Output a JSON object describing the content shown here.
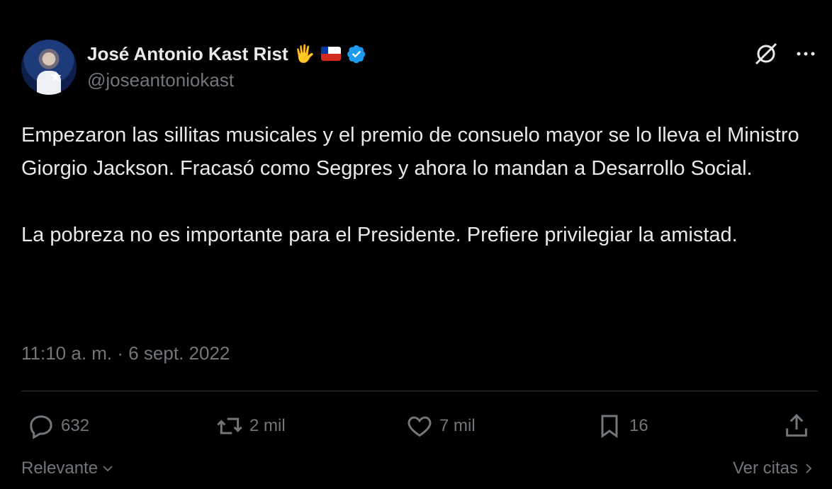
{
  "author": {
    "name": "José Antonio Kast Rist",
    "handle": "@joseantoniokast",
    "emoji": "🖐",
    "verified": true,
    "verified_color": "#1d9bf0"
  },
  "tweet": {
    "paragraphs": [
      "Empezaron las sillitas musicales y el premio de consuelo mayor se lo lleva el Ministro Giorgio Jackson. Fracasó como Segpres y ahora lo mandan a Desarrollo Social.",
      "La pobreza no es importante para el Presidente. Prefiere privilegiar la amistad."
    ],
    "timestamp": "11:10 a. m. · 6 sept. 2022"
  },
  "actions": {
    "replies": "632",
    "reposts": "2 mil",
    "likes": "7 mil",
    "bookmarks": "16"
  },
  "footer": {
    "sort_label": "Relevante",
    "quotes_label": "Ver citas"
  },
  "icons": [
    "grok-icon",
    "more-icon",
    "reply-icon",
    "repost-icon",
    "like-icon",
    "bookmark-icon",
    "share-icon",
    "chevron-down-icon",
    "chevron-right-icon"
  ]
}
